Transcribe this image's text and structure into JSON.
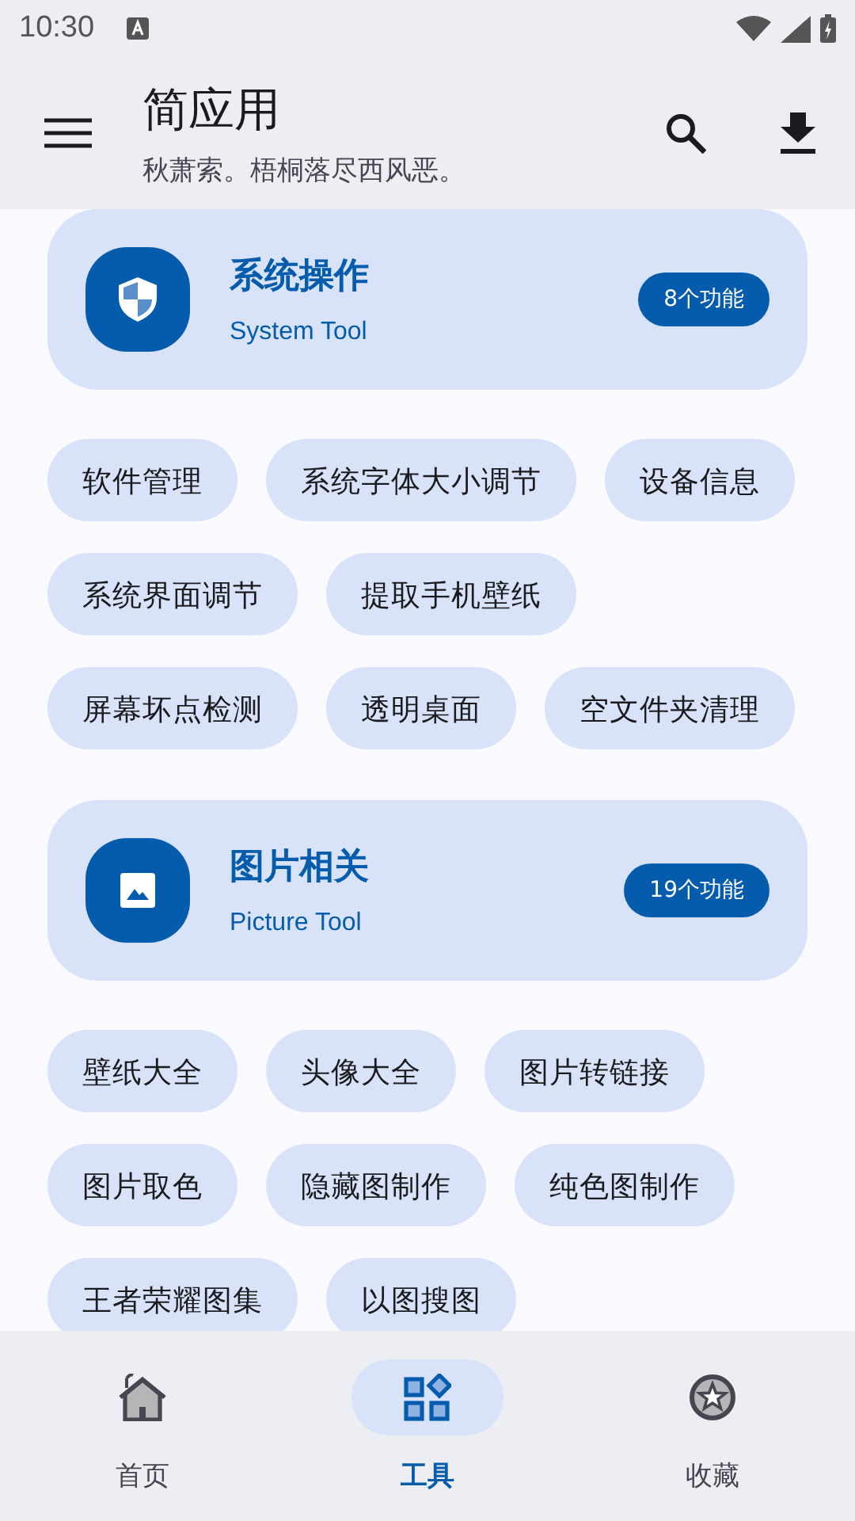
{
  "status_bar": {
    "time": "10:30"
  },
  "app_bar": {
    "title": "简应用",
    "subtitle": "秋萧索。梧桐落尽西风恶。"
  },
  "sections": [
    {
      "title": "系统操作",
      "subtitle": "System Tool",
      "count": "8个功能",
      "tools": [
        "软件管理",
        "系统字体大小调节",
        "设备信息",
        "系统界面调节",
        "提取手机壁纸",
        "屏幕坏点检测",
        "透明桌面",
        "空文件夹清理"
      ]
    },
    {
      "title": "图片相关",
      "subtitle": "Picture Tool",
      "count": "19个功能",
      "tools": [
        "壁纸大全",
        "头像大全",
        "图片转链接",
        "图片取色",
        "隐藏图制作",
        "纯色图制作",
        "王者荣耀图集",
        "以图搜图"
      ]
    }
  ],
  "bottom_nav": [
    {
      "label": "首页",
      "selected": false
    },
    {
      "label": "工具",
      "selected": true
    },
    {
      "label": "收藏",
      "selected": false
    }
  ]
}
